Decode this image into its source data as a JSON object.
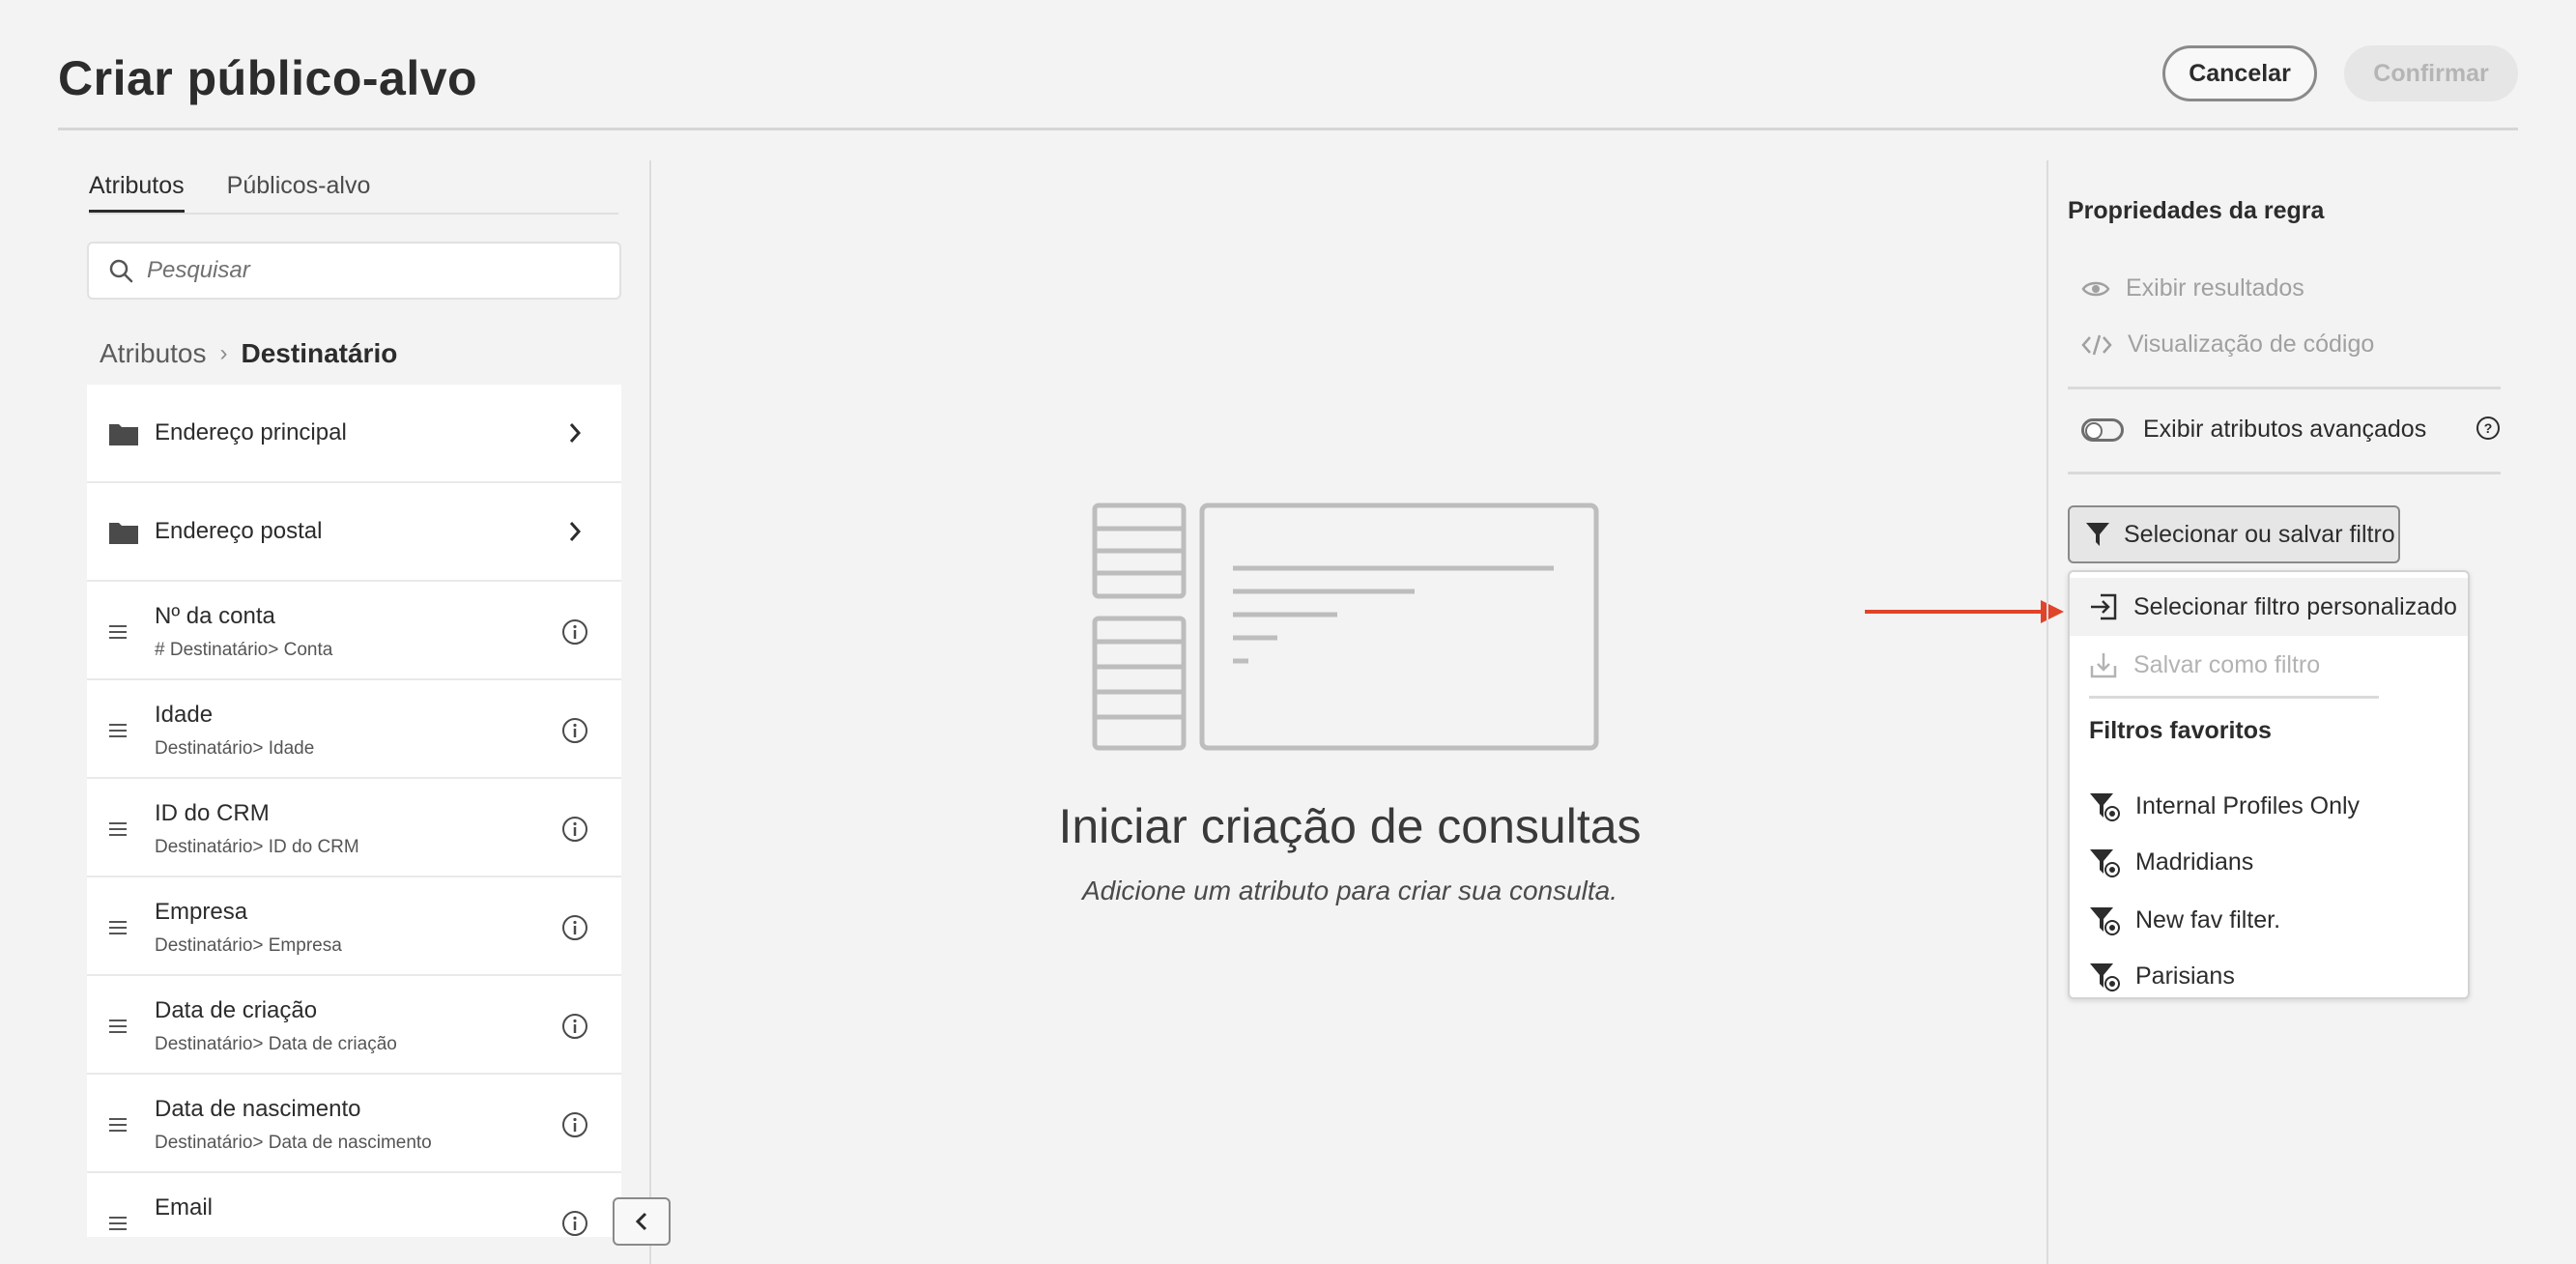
{
  "header": {
    "title": "Criar público-alvo",
    "cancel_label": "Cancelar",
    "confirm_label": "Confirmar"
  },
  "left_panel": {
    "tabs": [
      {
        "label": "Atributos",
        "active": true
      },
      {
        "label": "Públicos-alvo",
        "active": false
      }
    ],
    "search": {
      "placeholder": "Pesquisar"
    },
    "breadcrumb": {
      "parent": "Atributos",
      "separator": "›",
      "current": "Destinatário"
    },
    "folders": [
      {
        "label": "Endereço principal"
      },
      {
        "label": "Endereço postal"
      }
    ],
    "attributes": [
      {
        "name": "Nº da conta",
        "path": "# Destinatário> Conta"
      },
      {
        "name": "Idade",
        "path": "Destinatário> Idade"
      },
      {
        "name": "ID do CRM",
        "path": "Destinatário> ID do CRM"
      },
      {
        "name": "Empresa",
        "path": "Destinatário> Empresa"
      },
      {
        "name": "Data de criação",
        "path": "Destinatário> Data de criação"
      },
      {
        "name": "Data de nascimento",
        "path": "Destinatário> Data de nascimento"
      },
      {
        "name": "Email",
        "path": ""
      }
    ]
  },
  "center": {
    "title": "Iniciar criação de consultas",
    "subtitle": "Adicione um atributo para criar sua consulta."
  },
  "right_panel": {
    "title": "Propriedades da regra",
    "view_results": "Exibir resultados",
    "code_preview": "Visualização de código",
    "advanced_toggle_label": "Exibir atributos avançados",
    "filter_button": "Selecionar ou salvar filtro"
  },
  "dropdown": {
    "select_custom": "Selecionar filtro personalizado",
    "save_as_filter": "Salvar como filtro",
    "favorites_header": "Filtros favoritos",
    "favorites": [
      "Internal Profiles Only",
      "Madridians",
      "New fav filter.",
      "Parisians"
    ]
  },
  "colors": {
    "arrow": "#e0442b",
    "background": "#f3f3f3",
    "disabled_text": "#a0a0a0"
  }
}
